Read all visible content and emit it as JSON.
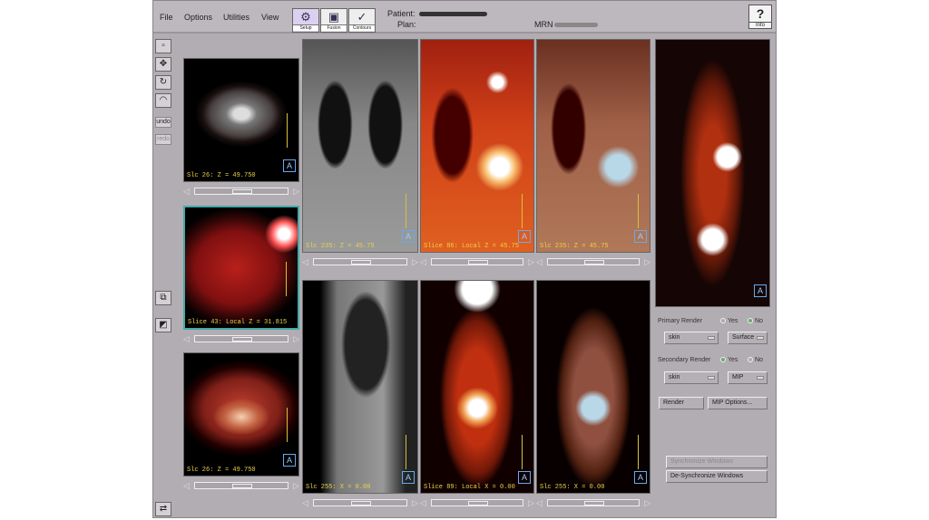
{
  "menu": [
    "File",
    "Options",
    "Utilities",
    "View"
  ],
  "toolbar": [
    {
      "label": "Setup",
      "icon": "setup-icon"
    },
    {
      "label": "Fusion",
      "icon": "fusion-icon"
    },
    {
      "label": "Contours",
      "icon": "contours-icon"
    }
  ],
  "header": {
    "patient_label": "Patient:",
    "plan_label": "Plan:",
    "mrn_label": "MRN",
    "help_label": "Info",
    "help_glyph": "?"
  },
  "tools": {
    "undo": "undo",
    "redo": "redo"
  },
  "views": {
    "axial_ct": "Slc 26: Z = 49.750",
    "axial_pet": "Slice 43: Local Z = 31.815",
    "axial_fused": "Slc 26: Z = 49.750",
    "coronal_ct": "Slc 235: Z = 45.75",
    "coronal_pet": "Slice 86: Local Z = 45.75",
    "coronal_fused": "Slc 235: Z = 45.75",
    "sagittal_ct": "Slc 255: X = 0.00",
    "sagittal_pet": "Slice 89: Local X = 0.00",
    "sagittal_fused": "Slc 255: X = 0.00",
    "corner_glyph": "A"
  },
  "render": {
    "primary_label": "Primary Render",
    "secondary_label": "Secondary Render",
    "yes": "Yes",
    "no": "No",
    "primary_yes": false,
    "secondary_yes": true,
    "primary_colormap": "skin",
    "primary_mode": "Surface",
    "secondary_colormap": "skin",
    "secondary_mode": "MIP",
    "render_button": "Render",
    "mip_options_button": "MIP Options...",
    "sync_button": "Synchronize Windows",
    "desync_button": "De-Synchronize Windows"
  }
}
